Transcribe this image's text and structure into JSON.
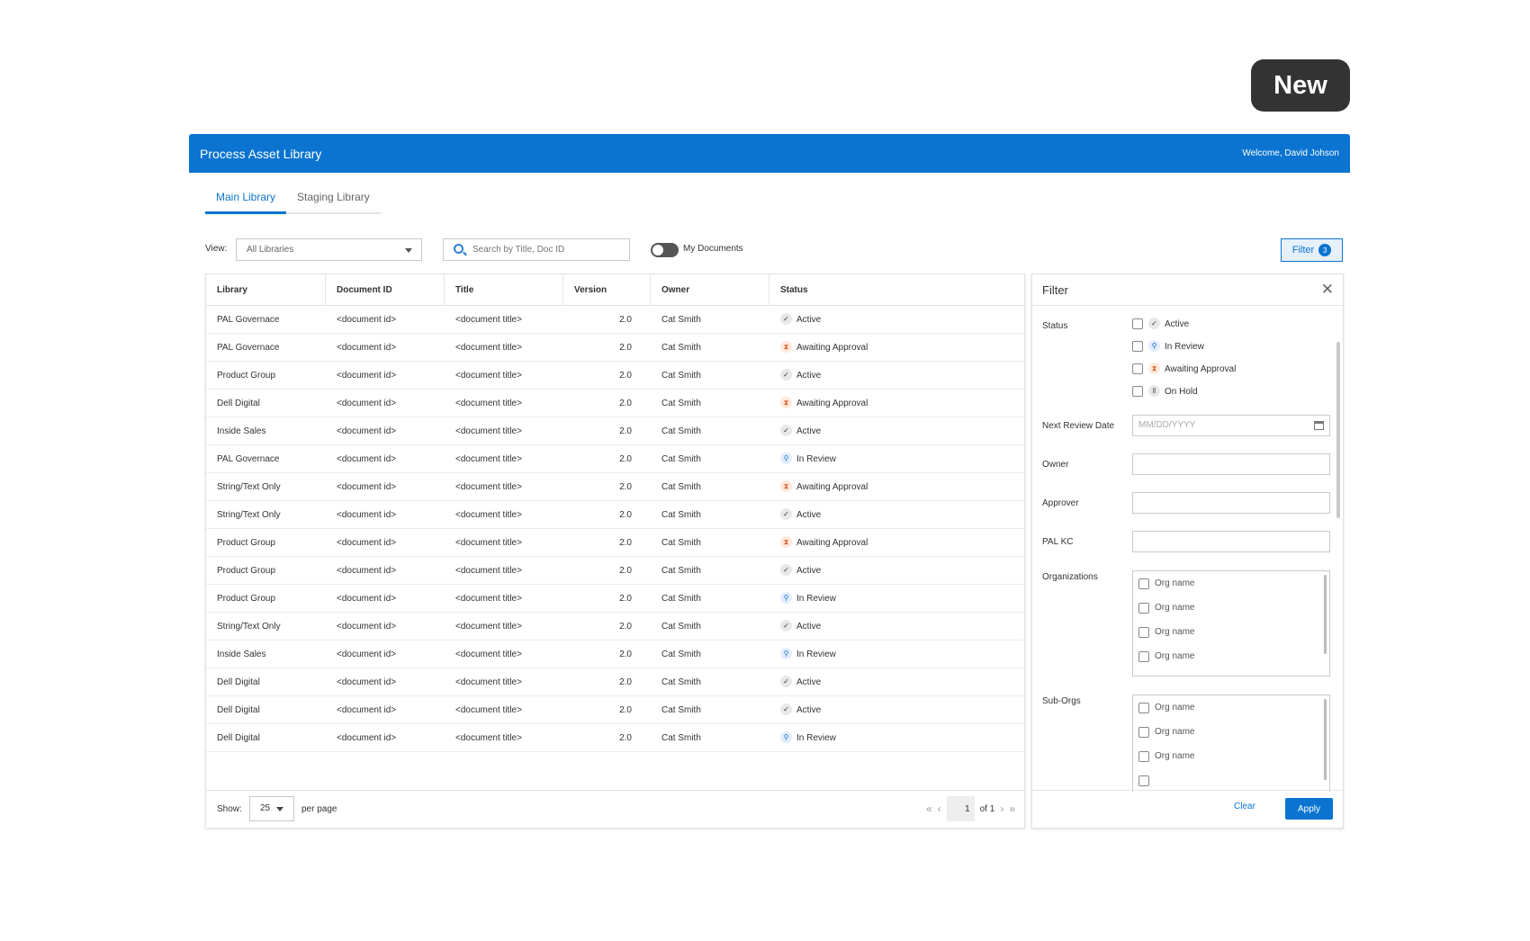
{
  "badge": "New",
  "app": {
    "title": "Process Asset Library",
    "welcome": "Welcome, David Johson"
  },
  "tabs": [
    {
      "label": "Main Library",
      "active": true
    },
    {
      "label": "Staging Library",
      "active": false
    }
  ],
  "toolbar": {
    "view_label": "View:",
    "view_value": "All Libraries",
    "search_placeholder": "Search by Title, Doc ID",
    "toggle_label": "My Documents",
    "filter_label": "Filter",
    "filter_count": "3"
  },
  "table": {
    "columns": [
      "Library",
      "Document ID",
      "Title",
      "Version",
      "Owner",
      "Status"
    ],
    "rows": [
      {
        "library": "PAL Governace",
        "doc_id": "<document id>",
        "title": "<document title>",
        "version": "2.0",
        "owner": "Cat Smith",
        "status": "Active"
      },
      {
        "library": "PAL Governace",
        "doc_id": "<document id>",
        "title": "<document title>",
        "version": "2.0",
        "owner": "Cat Smith",
        "status": "Awaiting Approval"
      },
      {
        "library": "Product Group",
        "doc_id": "<document id>",
        "title": "<document title>",
        "version": "2.0",
        "owner": "Cat Smith",
        "status": "Active"
      },
      {
        "library": "Dell Digital",
        "doc_id": "<document id>",
        "title": "<document title>",
        "version": "2.0",
        "owner": "Cat Smith",
        "status": "Awaiting Approval"
      },
      {
        "library": "Inside Sales",
        "doc_id": "<document id>",
        "title": "<document title>",
        "version": "2.0",
        "owner": "Cat Smith",
        "status": "Active"
      },
      {
        "library": "PAL Governace",
        "doc_id": "<document id>",
        "title": "<document title>",
        "version": "2.0",
        "owner": "Cat Smith",
        "status": "In Review"
      },
      {
        "library": "String/Text Only",
        "doc_id": "<document id>",
        "title": "<document title>",
        "version": "2.0",
        "owner": "Cat Smith",
        "status": "Awaiting Approval"
      },
      {
        "library": "String/Text Only",
        "doc_id": "<document id>",
        "title": "<document title>",
        "version": "2.0",
        "owner": "Cat Smith",
        "status": "Active"
      },
      {
        "library": "Product Group",
        "doc_id": "<document id>",
        "title": "<document title>",
        "version": "2.0",
        "owner": "Cat Smith",
        "status": "Awaiting Approval"
      },
      {
        "library": "Product Group",
        "doc_id": "<document id>",
        "title": "<document title>",
        "version": "2.0",
        "owner": "Cat Smith",
        "status": "Active"
      },
      {
        "library": "Product Group",
        "doc_id": "<document id>",
        "title": "<document title>",
        "version": "2.0",
        "owner": "Cat Smith",
        "status": "In Review"
      },
      {
        "library": "String/Text Only",
        "doc_id": "<document id>",
        "title": "<document title>",
        "version": "2.0",
        "owner": "Cat Smith",
        "status": "Active"
      },
      {
        "library": "Inside Sales",
        "doc_id": "<document id>",
        "title": "<document title>",
        "version": "2.0",
        "owner": "Cat Smith",
        "status": "In Review"
      },
      {
        "library": "Dell Digital",
        "doc_id": "<document id>",
        "title": "<document title>",
        "version": "2.0",
        "owner": "Cat Smith",
        "status": "Active"
      },
      {
        "library": "Dell Digital",
        "doc_id": "<document id>",
        "title": "<document title>",
        "version": "2.0",
        "owner": "Cat Smith",
        "status": "Active"
      },
      {
        "library": "Dell Digital",
        "doc_id": "<document id>",
        "title": "<document title>",
        "version": "2.0",
        "owner": "Cat Smith",
        "status": "In Review"
      }
    ]
  },
  "pagination": {
    "show_label": "Show:",
    "per_page_value": "25",
    "per_page_label": "per page",
    "page": "1",
    "of_label": "of 1"
  },
  "filter_panel": {
    "title": "Filter",
    "status_label": "Status",
    "status_options": [
      "Active",
      "In Review",
      "Awaiting Approval",
      "On Hold"
    ],
    "review_date_label": "Next Review Date",
    "review_date_placeholder": "MM/DD/YYYY",
    "owner_label": "Owner",
    "approver_label": "Approver",
    "palkc_label": "PAL KC",
    "orgs_label": "Organizations",
    "orgs": [
      "Org name",
      "Org name",
      "Org name",
      "Org name"
    ],
    "suborgs_label": "Sub-Orgs",
    "suborgs": [
      "Org name",
      "Org name",
      "Org name"
    ],
    "clear_label": "Clear",
    "apply_label": "Apply"
  },
  "status_colors": {
    "Active": "#555555",
    "Awaiting Approval": "#d9622b",
    "In Review": "#1a6fc9",
    "On Hold": "#555555"
  },
  "status_icons": {
    "Active": "check-icon",
    "Awaiting Approval": "hourglass-icon",
    "In Review": "magnifier-icon",
    "On Hold": "pause-icon"
  }
}
